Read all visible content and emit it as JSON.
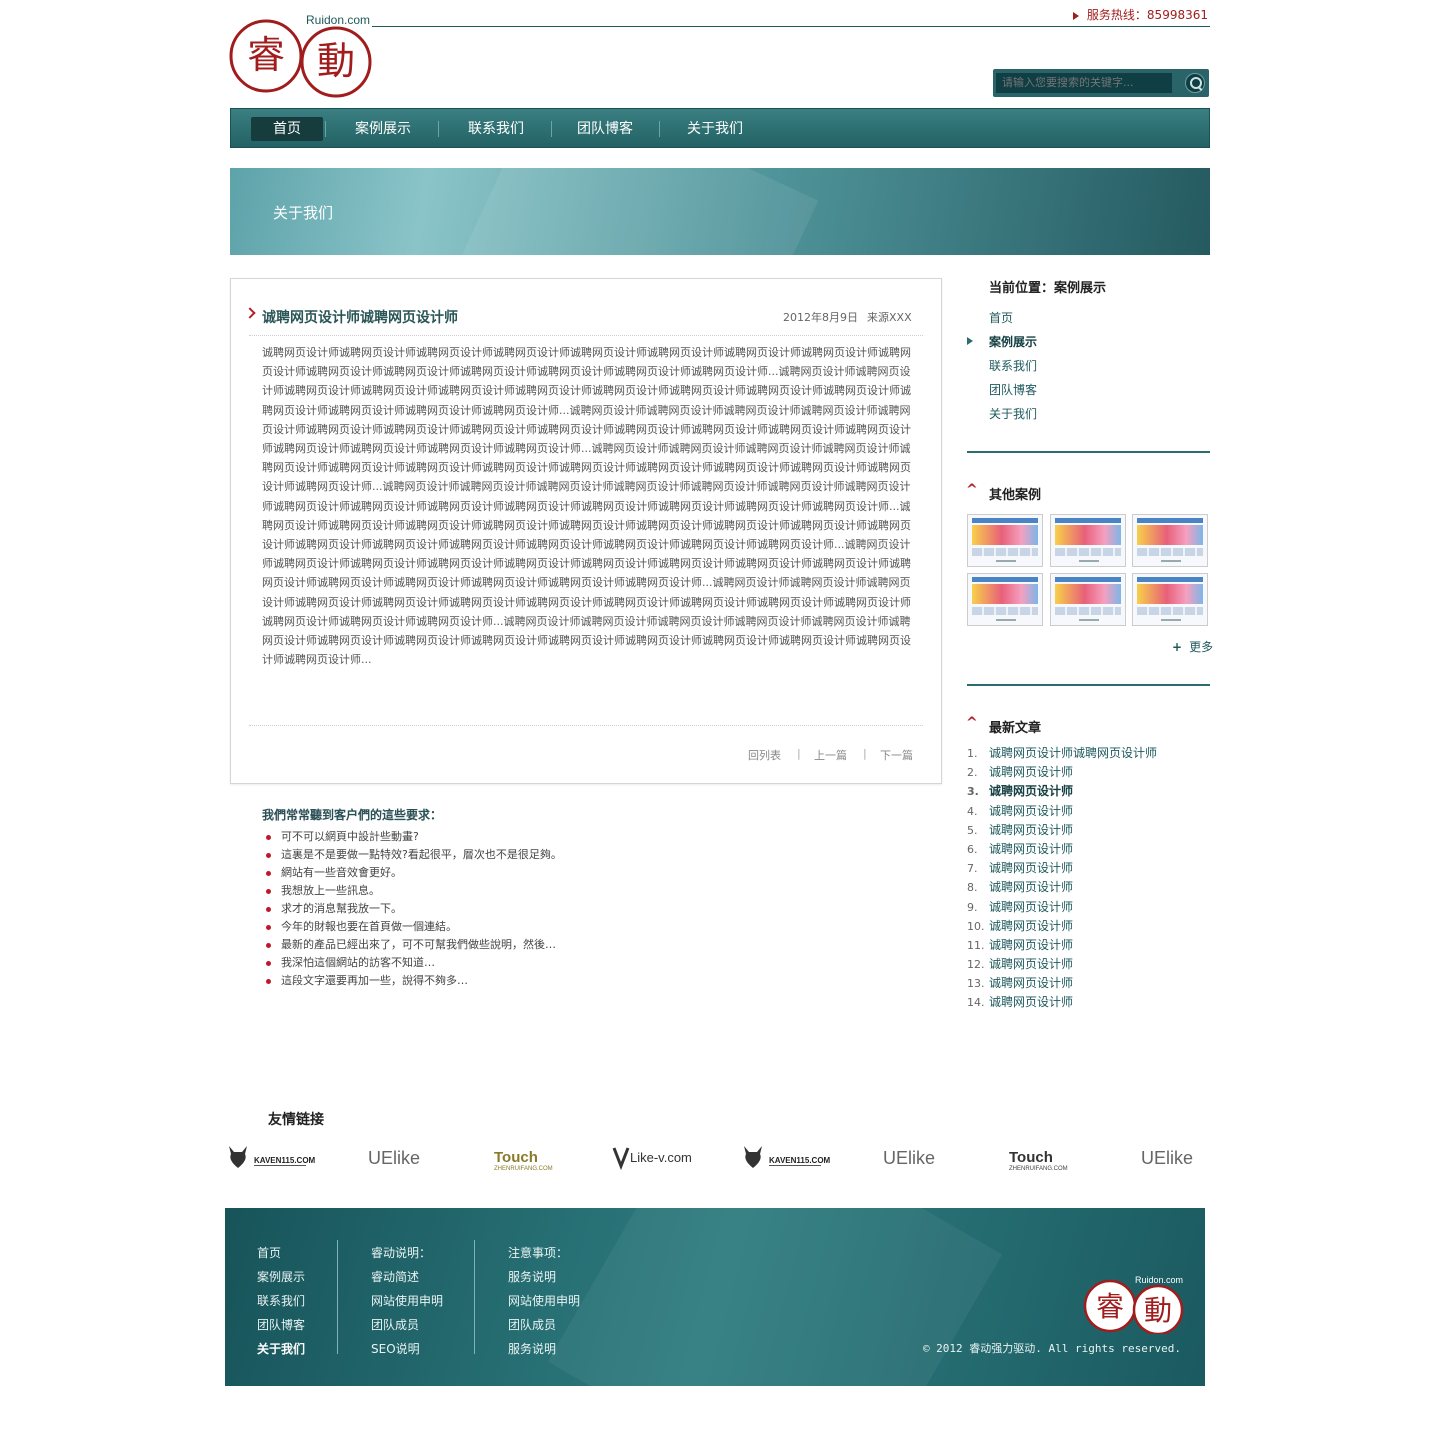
{
  "header": {
    "logo_site": "Ruidon.com",
    "logo_chars": [
      "睿",
      "動"
    ],
    "hotline_label": "服务热线：",
    "hotline_number": "85998361"
  },
  "search": {
    "placeholder": "请输入您要搜索的关键字..."
  },
  "nav": {
    "items": [
      {
        "label": "首页",
        "active": true
      },
      {
        "label": "案例展示",
        "active": false
      },
      {
        "label": "联系我们",
        "active": false
      },
      {
        "label": "团队博客",
        "active": false
      },
      {
        "label": "关于我们",
        "active": false
      }
    ]
  },
  "banner": {
    "title": "关于我们"
  },
  "article": {
    "title": "诚聘网页设计师诚聘网页设计师",
    "date": "2012年8月9日",
    "source": "来源XXX",
    "body": "诚聘网页设计师诚聘网页设计师诚聘网页设计师诚聘网页设计师诚聘网页设计师诚聘网页设计师诚聘网页设计师诚聘网页设计师诚聘网页设计师诚聘网页设计师诚聘网页设计师诚聘网页设计师诚聘网页设计师诚聘网页设计师诚聘网页设计师...诚聘网页设计师诚聘网页设计师诚聘网页设计师诚聘网页设计师诚聘网页设计师诚聘网页设计师诚聘网页设计师诚聘网页设计师诚聘网页设计师诚聘网页设计师诚聘网页设计师诚聘网页设计师诚聘网页设计师诚聘网页设计师...诚聘网页设计师诚聘网页设计师诚聘网页设计师诚聘网页设计师诚聘网页设计师诚聘网页设计师诚聘网页设计师诚聘网页设计师诚聘网页设计师诚聘网页设计师诚聘网页设计师诚聘网页设计师诚聘网页设计师诚聘网页设计师诚聘网页设计师诚聘网页设计师诚聘网页设计师...诚聘网页设计师诚聘网页设计师诚聘网页设计师诚聘网页设计师诚聘网页设计师诚聘网页设计师诚聘网页设计师诚聘网页设计师诚聘网页设计师诚聘网页设计师诚聘网页设计师诚聘网页设计师诚聘网页设计师诚聘网页设计师...诚聘网页设计师诚聘网页设计师诚聘网页设计师诚聘网页设计师诚聘网页设计师诚聘网页设计师诚聘网页设计师诚聘网页设计师诚聘网页设计师诚聘网页设计师诚聘网页设计师诚聘网页设计师诚聘网页设计师诚聘网页设计师诚聘网页设计师...诚聘网页设计师诚聘网页设计师诚聘网页设计师诚聘网页设计师诚聘网页设计师诚聘网页设计师诚聘网页设计师诚聘网页设计师诚聘网页设计师诚聘网页设计师诚聘网页设计师诚聘网页设计师诚聘网页设计师诚聘网页设计师诚聘网页设计师诚聘网页设计师...诚聘网页设计师诚聘网页设计师诚聘网页设计师诚聘网页设计师诚聘网页设计师诚聘网页设计师诚聘网页设计师诚聘网页设计师诚聘网页设计师诚聘网页设计师诚聘网页设计师诚聘网页设计师诚聘网页设计师诚聘网页设计师诚聘网页设计师...诚聘网页设计师诚聘网页设计师诚聘网页设计师诚聘网页设计师诚聘网页设计师诚聘网页设计师诚聘网页设计师诚聘网页设计师诚聘网页设计师诚聘网页设计师诚聘网页设计师诚聘网页设计师诚聘网页设计师诚聘网页设计师...诚聘网页设计师诚聘网页设计师诚聘网页设计师诚聘网页设计师诚聘网页设计师诚聘网页设计师诚聘网页设计师诚聘网页设计师诚聘网页设计师诚聘网页设计师诚聘网页设计师诚聘网页设计师诚聘网页设计师诚聘网页设计师诚聘网页设计师...",
    "back_label": "回列表",
    "prev_label": "上一篇",
    "next_label": "下一篇"
  },
  "requirements": {
    "title": "我們常常聽到客户們的這些要求：",
    "items": [
      "可不可以網頁中設計些動畫?",
      "這裏是不是要做一點特效?看起很平，層次也不是很足夠。",
      "網站有一些音效會更好。",
      "我想放上一些訊息。",
      "求才的消息幫我放一下。",
      "今年的財報也要在首頁做一個連結。",
      "最新的產品已經出來了，可不可幫我們做些說明，然後…",
      "我深怕這個網站的訪客不知道…",
      "這段文字還要再加一些，說得不夠多…"
    ]
  },
  "sidebar": {
    "location_title": "当前位置：案例展示",
    "location_links": [
      {
        "label": "首页",
        "active": false
      },
      {
        "label": "案例展示",
        "active": true
      },
      {
        "label": "联系我们",
        "active": false
      },
      {
        "label": "团队博客",
        "active": false
      },
      {
        "label": "关于我们",
        "active": false
      }
    ],
    "cases_title": "其他案例",
    "more_label": "更多",
    "latest_title": "最新文章",
    "latest": [
      {
        "num": "1.",
        "title": "诚聘网页设计师诚聘网页设计师",
        "bold": false
      },
      {
        "num": "2.",
        "title": "诚聘网页设计师",
        "bold": false
      },
      {
        "num": "3.",
        "title": "诚聘网页设计师",
        "bold": true
      },
      {
        "num": "4.",
        "title": "诚聘网页设计师",
        "bold": false
      },
      {
        "num": "5.",
        "title": "诚聘网页设计师",
        "bold": false
      },
      {
        "num": "6.",
        "title": "诚聘网页设计师",
        "bold": false
      },
      {
        "num": "7.",
        "title": "诚聘网页设计师",
        "bold": false
      },
      {
        "num": "8.",
        "title": "诚聘网页设计师",
        "bold": false
      },
      {
        "num": "9.",
        "title": "诚聘网页设计师",
        "bold": false
      },
      {
        "num": "10.",
        "title": "诚聘网页设计师",
        "bold": false
      },
      {
        "num": "11.",
        "title": "诚聘网页设计师",
        "bold": false
      },
      {
        "num": "12.",
        "title": "诚聘网页设计师",
        "bold": false
      },
      {
        "num": "13.",
        "title": "诚聘网页设计师",
        "bold": false
      },
      {
        "num": "14.",
        "title": "诚聘网页设计师",
        "bold": false
      }
    ]
  },
  "friends": {
    "title": "友情链接",
    "logos": [
      {
        "name": "KAVEN115.COM",
        "icon": "kaven-logo"
      },
      {
        "name": "UElike",
        "icon": "uelike-logo"
      },
      {
        "name": "Touch",
        "sub": "ZHENRUIFANG.COM",
        "icon": "touch-logo"
      },
      {
        "name": "Like-v.com",
        "icon": "likev-logo"
      },
      {
        "name": "KAVEN115.COM",
        "icon": "kaven-logo"
      },
      {
        "name": "UElike",
        "icon": "uelike-logo"
      },
      {
        "name": "Touch",
        "sub": "ZHENRUIFANG.COM",
        "icon": "touch-logo"
      },
      {
        "name": "UElike",
        "icon": "uelike-logo"
      }
    ]
  },
  "footer": {
    "col1": [
      "首页",
      "案例展示",
      "联系我们",
      "团队博客",
      "关于我们"
    ],
    "col2": [
      "睿动说明：",
      "睿动简述",
      "网站使用申明",
      "团队成员",
      "SEO说明"
    ],
    "col3": [
      "注意事项：",
      "服务说明",
      "网站使用申明",
      "团队成员",
      "服务说明"
    ],
    "logo_site": "Ruidon.com",
    "copyright": "© 2012 睿动强力驱动. All rights reserved."
  },
  "colors": {
    "brand_red": "#a11c1c",
    "brand_teal": "#2c6c70",
    "nav_active": "#173c3e"
  }
}
